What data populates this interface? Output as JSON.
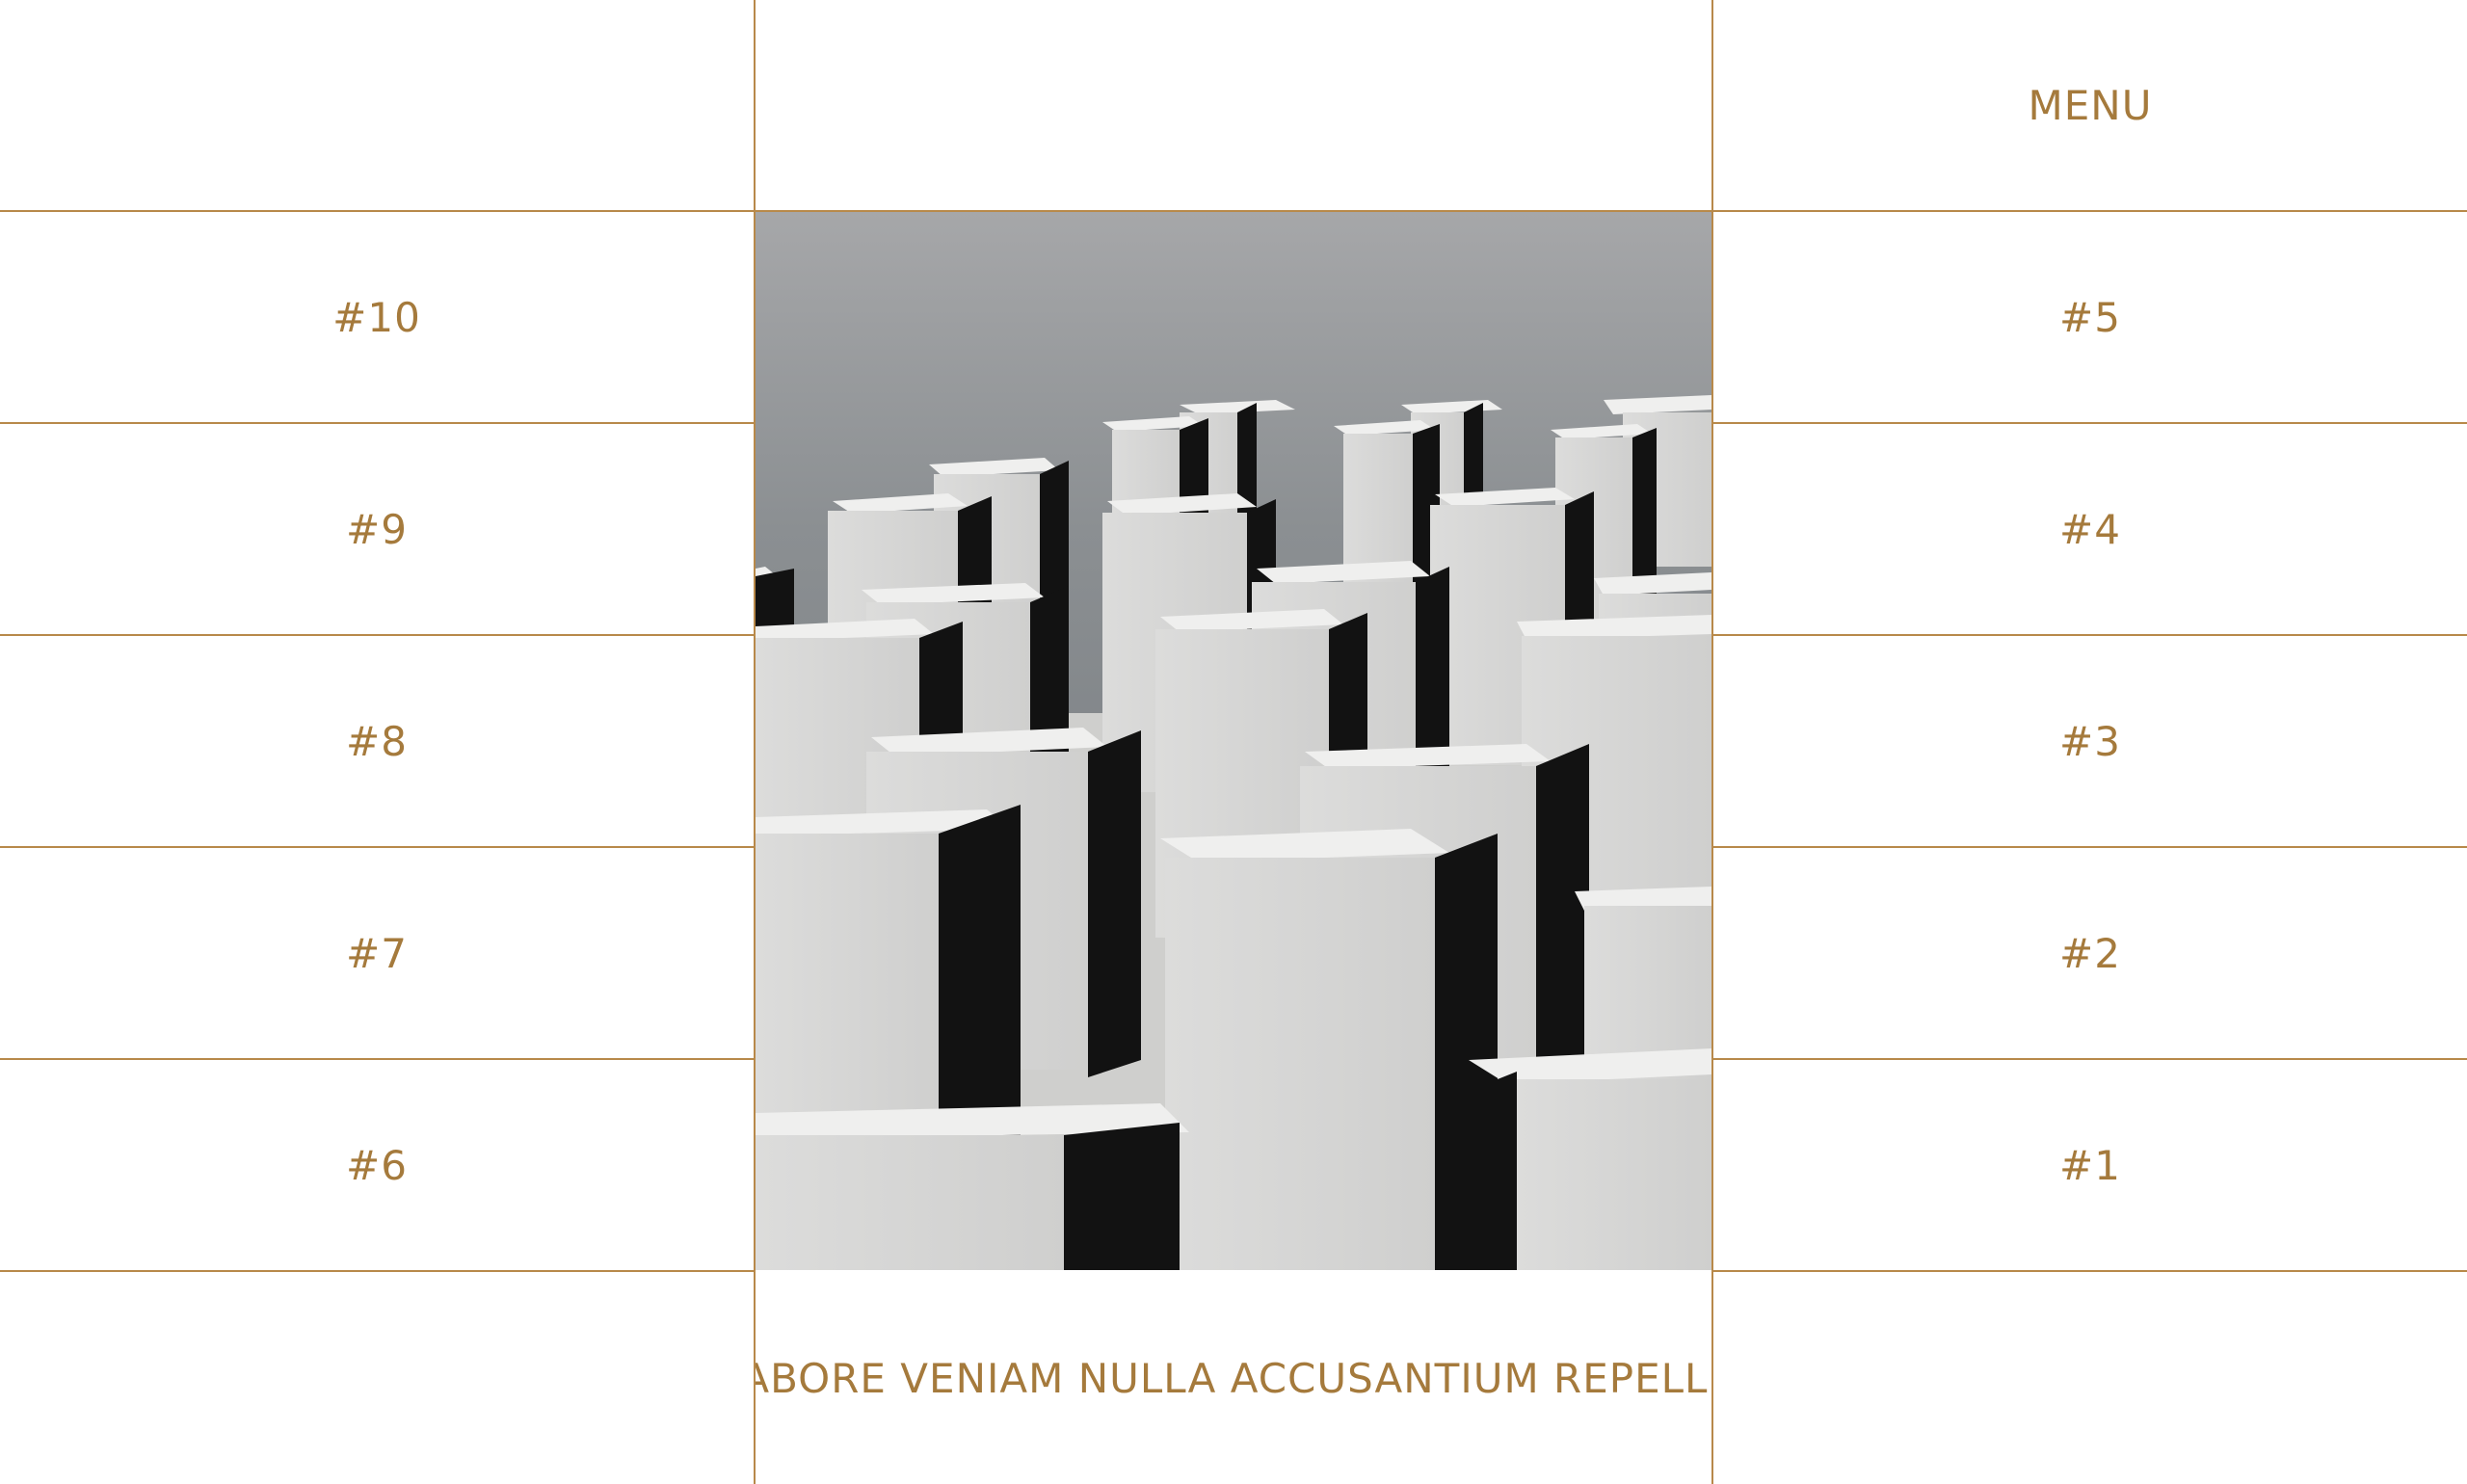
{
  "menu": {
    "label": "MENU"
  },
  "left_items": [
    {
      "label": "#10"
    },
    {
      "label": "#9"
    },
    {
      "label": "#8"
    },
    {
      "label": "#7"
    },
    {
      "label": "#6"
    }
  ],
  "right_items": [
    {
      "label": "#5"
    },
    {
      "label": "#4"
    },
    {
      "label": "#3"
    },
    {
      "label": "#2"
    },
    {
      "label": "#1"
    }
  ],
  "ticker": {
    "text": "LABORE VENIAM NULLA ACCUSANTIUM REPELLENDUS"
  },
  "colors": {
    "accent": "#a57a3c",
    "line": "#b8894a",
    "background": "#ffffff"
  }
}
